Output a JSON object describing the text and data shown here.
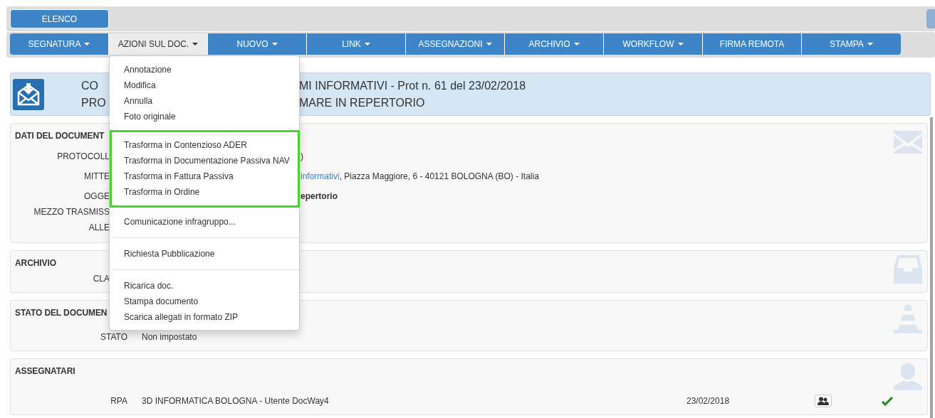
{
  "top_bar": {
    "list_button": "ELENCO"
  },
  "nav": [
    {
      "label": "SEGNATURA",
      "caret": true,
      "selected": false
    },
    {
      "label": "AZIONI SUL DOC.",
      "caret": true,
      "selected": true
    },
    {
      "label": "NUOVO",
      "caret": true,
      "selected": false
    },
    {
      "label": "LINK",
      "caret": true,
      "selected": false
    },
    {
      "label": "ASSEGNAZIONI",
      "caret": true,
      "selected": false
    },
    {
      "label": "ARCHIVIO",
      "caret": true,
      "selected": false
    },
    {
      "label": "WORKFLOW",
      "caret": true,
      "selected": false
    },
    {
      "label": "FIRMA REMOTA",
      "caret": false,
      "selected": false
    },
    {
      "label": "STAMPA",
      "caret": true,
      "selected": false
    }
  ],
  "header": {
    "lines": [
      {
        "left": "CO",
        "right": "MI INFORMATIVI - Prot n. 61 del 23/02/2018"
      },
      {
        "left": "PRO",
        "right": "MARE IN REPERTORIO"
      }
    ]
  },
  "panels": [
    {
      "title": "DATI DEL DOCUMENT",
      "rows": [
        {
          "kind": "under_menu",
          "label": "PROTOCOLL",
          "value": ")"
        },
        {
          "kind": "under_menu",
          "label": "MITTE",
          "link": "informativi",
          "value": ", Piazza Maggiore, 6 - 40121 BOLOGNA (BO) - Italia"
        },
        {
          "kind": "under_menu",
          "label": "OGGE",
          "value": "epertorio",
          "bold": true
        },
        {
          "kind": "under_menu",
          "label": "MEZZO TRASMISS"
        },
        {
          "kind": "under_menu",
          "label": "ALLE"
        }
      ]
    },
    {
      "title": "ARCHIVIO",
      "rows": [
        {
          "kind": "under_menu",
          "label": "CLA"
        }
      ]
    },
    {
      "title": "STATO DEL DOCUMEN",
      "rows": [
        {
          "kind": "plain",
          "label": "STATO",
          "value": "Non impostato"
        }
      ]
    },
    {
      "title": "ASSEGNATARI",
      "rows": [
        {
          "kind": "plain",
          "label": "RPA",
          "value": "3D INFORMATICA BOLOGNA - Utente DocWay4",
          "date": "23/02/2018",
          "action": true,
          "done": true
        }
      ]
    }
  ],
  "menu": {
    "groups": [
      {
        "highlighted": false,
        "items": [
          "Annotazione",
          "Modifica",
          "Annulla",
          "Foto originale"
        ]
      },
      {
        "highlighted": true,
        "items": [
          "Trasforma in Contenzioso ADER",
          "Trasforma in Documentazione Passiva NAV",
          "Trasforma in Fattura Passiva",
          "Trasforma in Ordine"
        ]
      },
      {
        "highlighted": false,
        "items": [
          "Comunicazione infragruppo..."
        ]
      },
      {
        "highlighted": false,
        "items": [
          "Richiesta Pubblicazione"
        ]
      },
      {
        "highlighted": false,
        "items": [
          "Ricarica doc.",
          "Stampa documento",
          "Scarica allegati in formato ZIP"
        ]
      }
    ]
  }
}
